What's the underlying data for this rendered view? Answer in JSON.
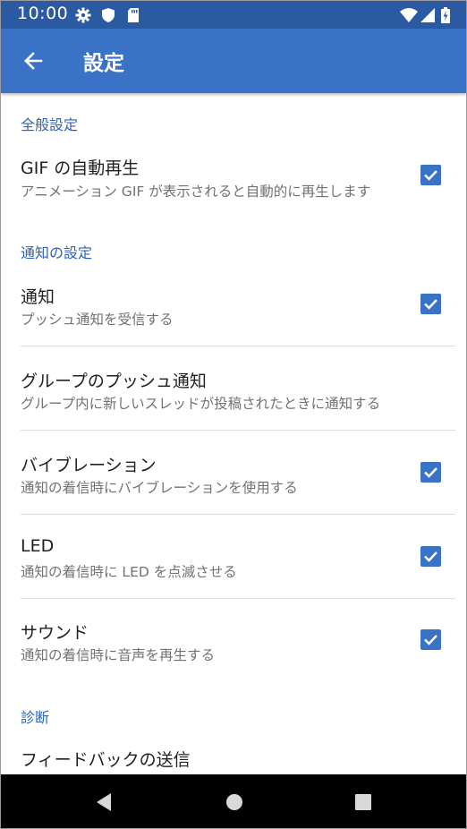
{
  "status_bar": {
    "time": "10:00",
    "icons": [
      "gear-icon",
      "shield-icon",
      "sd-card-icon",
      "wifi-icon",
      "signal-icon",
      "battery-charging-icon"
    ]
  },
  "app_bar": {
    "title": "設定",
    "back_icon": "arrow-back-icon",
    "color": "#3a73c5"
  },
  "sections": [
    {
      "header": "全般設定",
      "items": [
        {
          "title": "GIF の自動再生",
          "summary": "アニメーション GIF が表示されると自動的に再生します",
          "checked": true
        }
      ]
    },
    {
      "header": "通知の設定",
      "items": [
        {
          "title": "通知",
          "summary": "プッシュ通知を受信する",
          "checked": true
        },
        {
          "title": "グループのプッシュ通知",
          "summary": "グループ内に新しいスレッドが投稿されたときに通知する"
        },
        {
          "title": "バイブレーション",
          "summary": "通知の着信時にバイブレーションを使用する",
          "checked": true
        },
        {
          "title": "LED",
          "summary": "通知の着信時に LED を点滅させる",
          "checked": true
        },
        {
          "title": "サウンド",
          "summary": "通知の着信時に音声を再生する",
          "checked": true
        }
      ]
    },
    {
      "header": "診断",
      "items": [
        {
          "title": "フィードバックの送信"
        }
      ]
    }
  ],
  "nav_bar": {
    "buttons": [
      "back-triangle-icon",
      "home-circle-icon",
      "recents-square-icon"
    ]
  },
  "colors": {
    "status_bar": "#2b5aa3",
    "accent": "#3a73c5",
    "section_header": "#2f63b4"
  }
}
